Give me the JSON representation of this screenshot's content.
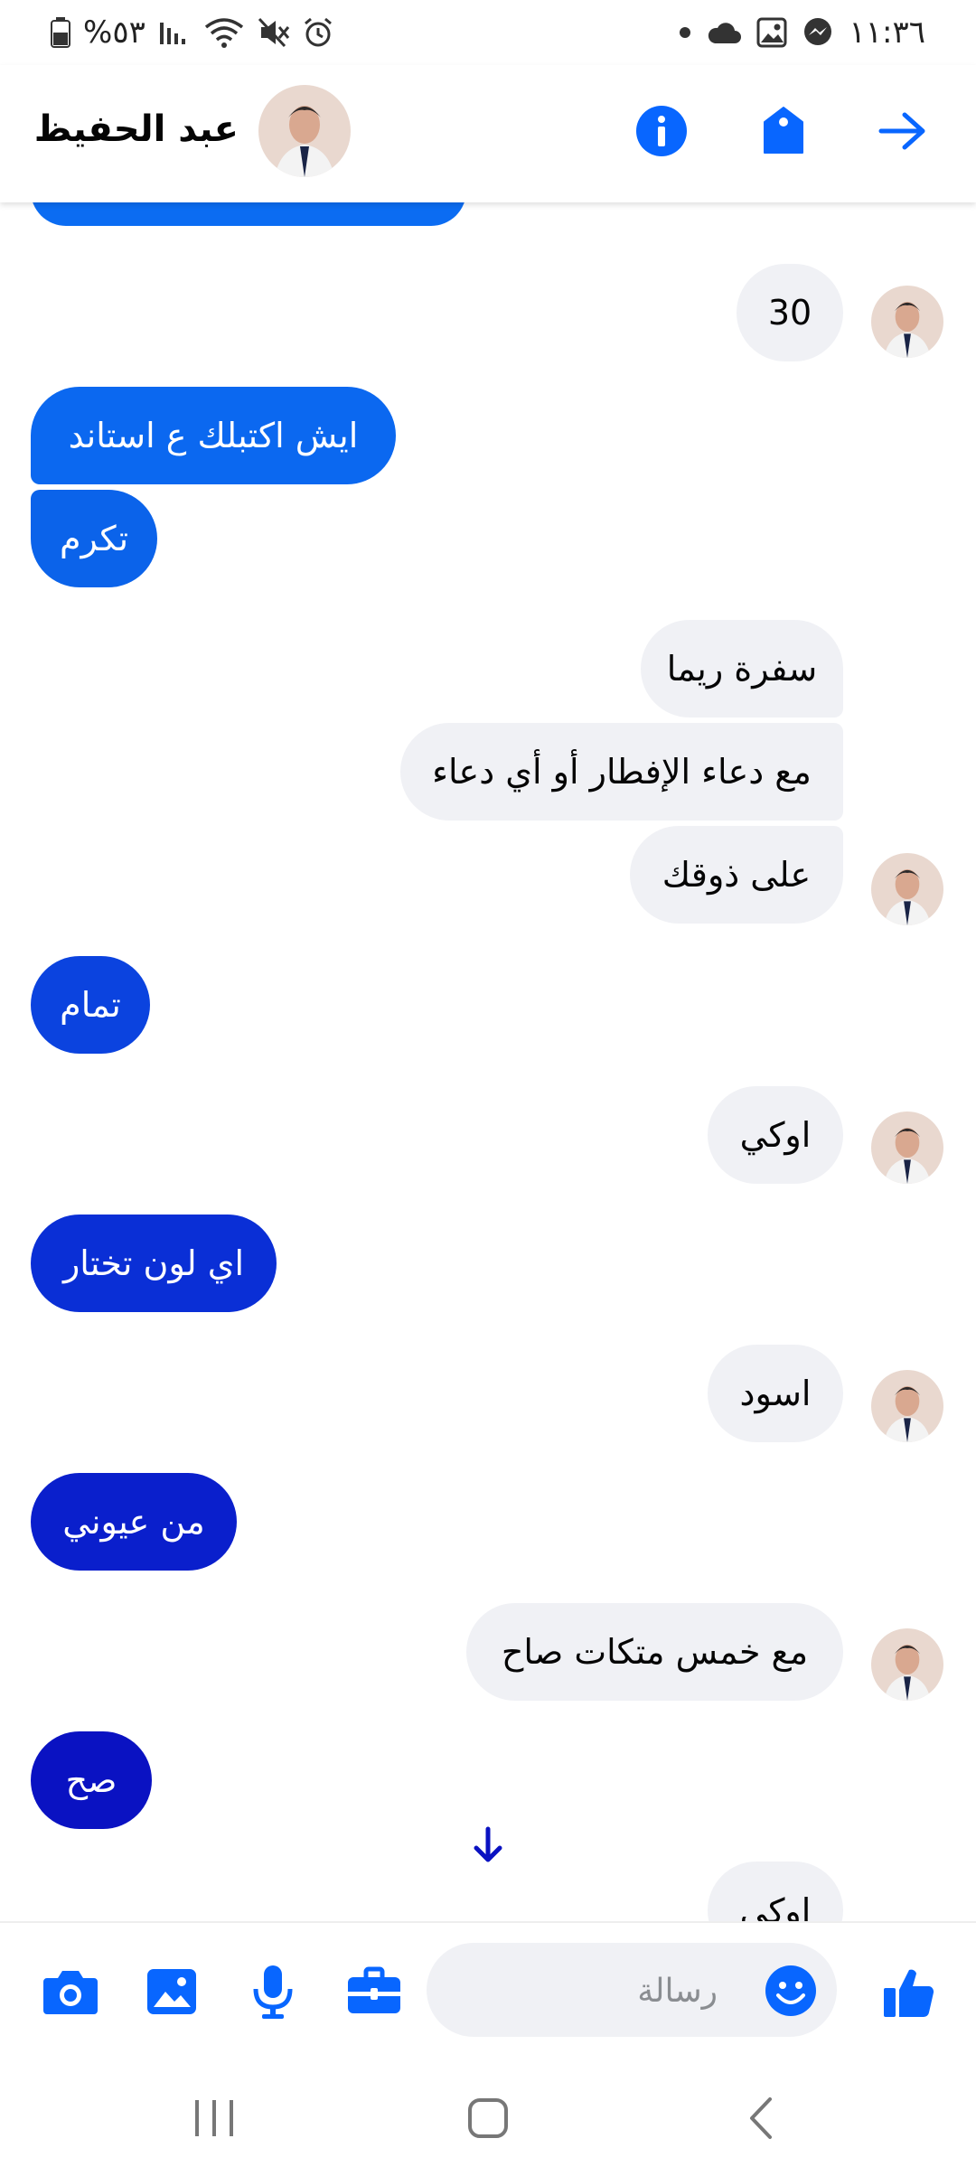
{
  "status_bar": {
    "battery_text": "%٥٣",
    "time": "١١:٣٦"
  },
  "header": {
    "contact_name": "عبد الحفيظ",
    "avatar_icon": "person-photo-icon",
    "icons": [
      "info-icon",
      "tag-icon",
      "arrow-forward-icon"
    ]
  },
  "messages": [
    {
      "dir": "in",
      "text": "30"
    },
    {
      "dir": "out",
      "text": "ايش اكتبلك ع استاند",
      "color": "#0b68f0"
    },
    {
      "dir": "out",
      "text": "تكرم",
      "color": "#0b63ea"
    },
    {
      "dir": "in",
      "text": "سفرة ريما"
    },
    {
      "dir": "in",
      "text": "مع دعاء الإفطار أو أي دعاء"
    },
    {
      "dir": "in",
      "text": "على ذوقك"
    },
    {
      "dir": "out",
      "text": "تمام",
      "color": "#0b43df"
    },
    {
      "dir": "in",
      "text": "اوكي"
    },
    {
      "dir": "out",
      "text": "اي لون تختار",
      "color": "#0a2fd6"
    },
    {
      "dir": "in",
      "text": "اسود"
    },
    {
      "dir": "out",
      "text": "من عيوني",
      "color": "#0a1fcc"
    },
    {
      "dir": "in",
      "text": "مع خمس متكات صاح"
    },
    {
      "dir": "out",
      "text": "صح",
      "color": "#0a12c2"
    },
    {
      "dir": "in",
      "text": "اوكي"
    }
  ],
  "composer": {
    "placeholder": "رسالة",
    "value": "",
    "icons": [
      "camera-icon",
      "image-icon",
      "microphone-icon",
      "toolbox-icon",
      "emoji-icon",
      "thumbs-up-icon"
    ]
  },
  "colors": {
    "accent": "#0866ff",
    "incoming_bubble": "#f0f1f5",
    "scroll_arrow": "#0a12c2"
  }
}
